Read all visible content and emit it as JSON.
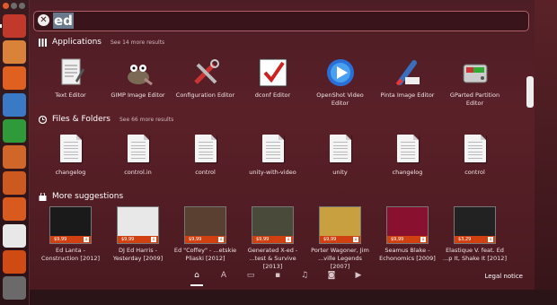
{
  "window_controls": [
    "#e05a2b",
    "#6d6d6d",
    "#6d6d6d"
  ],
  "search": {
    "query_selected": "ed",
    "icon": "close-search-icon"
  },
  "categories": {
    "applications": {
      "label": "Applications",
      "more": "See 14 more results",
      "icon": "applications-icon"
    },
    "files": {
      "label": "Files & Folders",
      "more": "See 66 more results",
      "icon": "clock-icon"
    },
    "suggestions": {
      "label": "More suggestions",
      "icon": "shopping-bag-icon"
    }
  },
  "apps": [
    {
      "label": "Text Editor",
      "icon": "text-editor-icon"
    },
    {
      "label": "GIMP Image Editor",
      "icon": "gimp-icon"
    },
    {
      "label": "Configuration Editor",
      "icon": "tools-icon"
    },
    {
      "label": "dconf Editor",
      "icon": "dconf-icon"
    },
    {
      "label": "OpenShot Video Editor",
      "icon": "openshot-icon"
    },
    {
      "label": "Pinta Image Editor",
      "icon": "pinta-icon"
    },
    {
      "label": "GParted Partition Editor",
      "icon": "gparted-icon"
    }
  ],
  "files": [
    {
      "label": "changelog"
    },
    {
      "label": "control.in"
    },
    {
      "label": "control"
    },
    {
      "label": "unity-with-video"
    },
    {
      "label": "unity"
    },
    {
      "label": "changelog"
    },
    {
      "label": "control"
    }
  ],
  "suggestions": [
    {
      "label": "Ed Lanta - Construction [2012]",
      "price": "$9,99",
      "color": "#1a1a1a"
    },
    {
      "label": "DJ Ed Harris - Yesterday [2009]",
      "price": "$9,99",
      "color": "#e8e8e8"
    },
    {
      "label": "Ed \"Coffey\" - ...etskie Pliaski [2012]",
      "price": "$9,99",
      "color": "#5a4030"
    },
    {
      "label": "Generated X-ed - ...test & Survive [2013]",
      "price": "$9,99",
      "color": "#4a4a3a"
    },
    {
      "label": "Porter Wagoner, Jim ...ville Legends [2007]",
      "price": "$9,99",
      "color": "#c8a040"
    },
    {
      "label": "Seamus Blake - Echonomics [2009]",
      "price": "$9,99",
      "color": "#8a1030"
    },
    {
      "label": "Elastique V. feat. Ed ...p It, Shake It [2012]",
      "price": "$3,29",
      "color": "#222"
    }
  ],
  "filters": [
    {
      "name": "home-filter-icon",
      "glyph": "⌂"
    },
    {
      "name": "apps-filter-icon",
      "glyph": "A"
    },
    {
      "name": "files-filter-icon",
      "glyph": "▭"
    },
    {
      "name": "social-filter-icon",
      "glyph": "▪"
    },
    {
      "name": "music-filter-icon",
      "glyph": "♫"
    },
    {
      "name": "photos-filter-icon",
      "glyph": "◙"
    },
    {
      "name": "video-filter-icon",
      "glyph": "▶"
    }
  ],
  "legal": "Legal notice",
  "launcher": [
    {
      "name": "dash-home-icon",
      "color": "#c0392b"
    },
    {
      "name": "files-icon",
      "color": "#d9823a"
    },
    {
      "name": "firefox-icon",
      "color": "#e06020"
    },
    {
      "name": "writer-icon",
      "color": "#3a79c6"
    },
    {
      "name": "calc-icon",
      "color": "#2f9a3a"
    },
    {
      "name": "impress-icon",
      "color": "#d0662a"
    },
    {
      "name": "software-center-icon",
      "color": "#cc5a20"
    },
    {
      "name": "ubuntu-one-icon",
      "color": "#d85a1f"
    },
    {
      "name": "amazon-icon",
      "color": "#e8e8e8"
    },
    {
      "name": "ubuntu-one-music-icon",
      "color": "#d04a14"
    },
    {
      "name": "system-settings-icon",
      "color": "#6a6a6a"
    }
  ]
}
